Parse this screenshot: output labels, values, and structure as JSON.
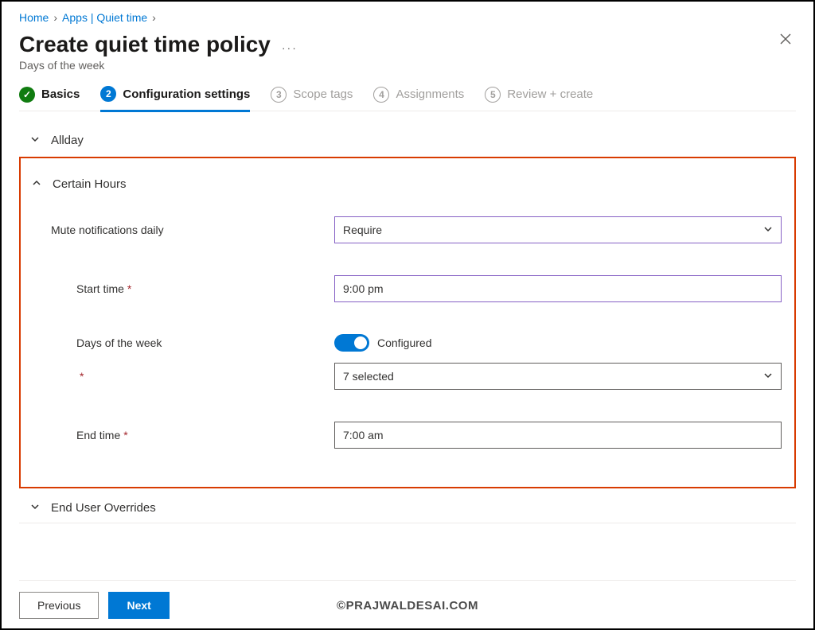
{
  "breadcrumbs": {
    "home": "Home",
    "apps": "Apps | Quiet time"
  },
  "header": {
    "title": "Create quiet time policy",
    "subtitle": "Days of the week",
    "more": "···"
  },
  "wizard": {
    "s1": "Basics",
    "s2_num": "2",
    "s2": "Configuration settings",
    "s3_num": "3",
    "s3": "Scope tags",
    "s4_num": "4",
    "s4": "Assignments",
    "s5_num": "5",
    "s5": "Review + create"
  },
  "sections": {
    "allday": "Allday",
    "certain": "Certain Hours",
    "overrides": "End User Overrides"
  },
  "form": {
    "mute_label": "Mute notifications daily",
    "mute_value": "Require",
    "start_label": "Start time",
    "start_value": "9:00 pm",
    "days_label": "Days of the week",
    "days_toggle_text": "Configured",
    "days_select_value": "7 selected",
    "end_label": "End time",
    "end_value": "7:00 am"
  },
  "buttons": {
    "prev": "Previous",
    "next": "Next"
  },
  "watermark": "©PRAJWALDESAI.COM"
}
